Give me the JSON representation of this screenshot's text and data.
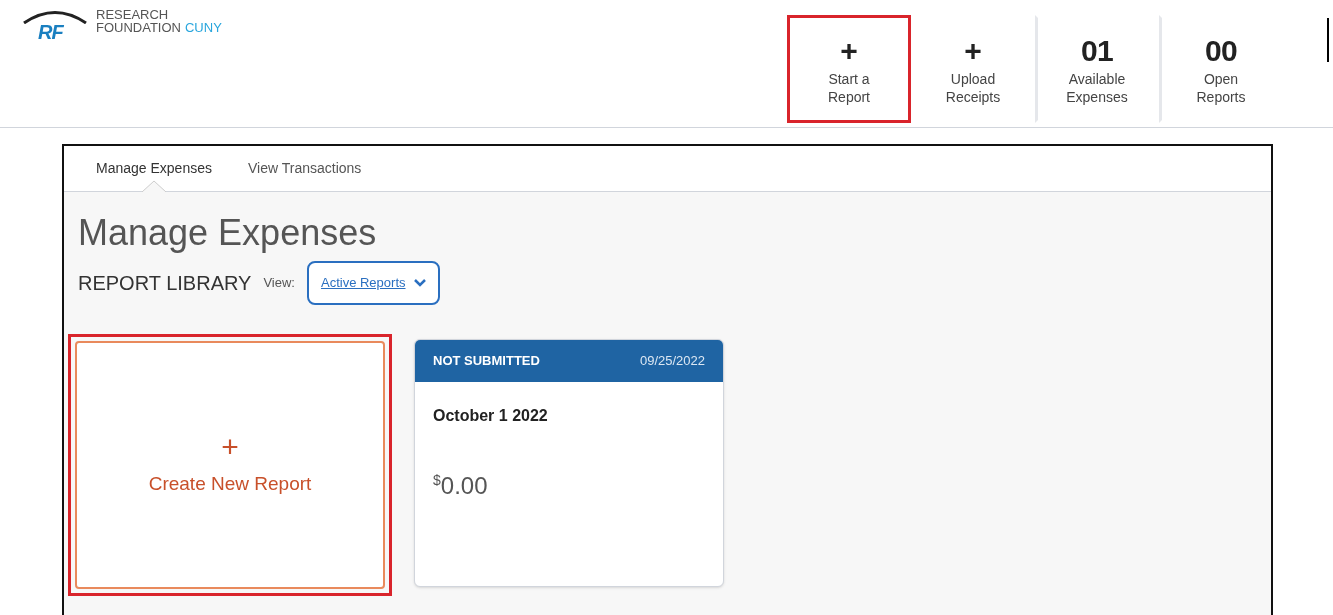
{
  "logo": {
    "mark": "RF",
    "line1": "RESEARCH",
    "line2": "FOUNDATION",
    "accent": "CUNY"
  },
  "quick_actions": [
    {
      "kind": "action",
      "icon": "+",
      "label": "Start a Report",
      "highlighted": true
    },
    {
      "kind": "action",
      "icon": "+",
      "label": "Upload Receipts",
      "highlighted": false
    },
    {
      "kind": "count",
      "count": "01",
      "label": "Available Expenses",
      "highlighted": false
    },
    {
      "kind": "count",
      "count": "00",
      "label": "Open Reports",
      "highlighted": false
    }
  ],
  "tabs": [
    {
      "label": "Manage Expenses",
      "selected": true
    },
    {
      "label": "View Transactions",
      "selected": false
    }
  ],
  "page_title": "Manage Expenses",
  "library": {
    "heading": "REPORT LIBRARY",
    "view_label": "View:",
    "view_value": "Active Reports"
  },
  "create_tile": {
    "icon": "+",
    "label": "Create New Report",
    "highlighted": true
  },
  "reports": [
    {
      "status": "NOT SUBMITTED",
      "date": "09/25/2022",
      "name": "October 1 2022",
      "currency": "$",
      "amount": "0.00"
    }
  ]
}
